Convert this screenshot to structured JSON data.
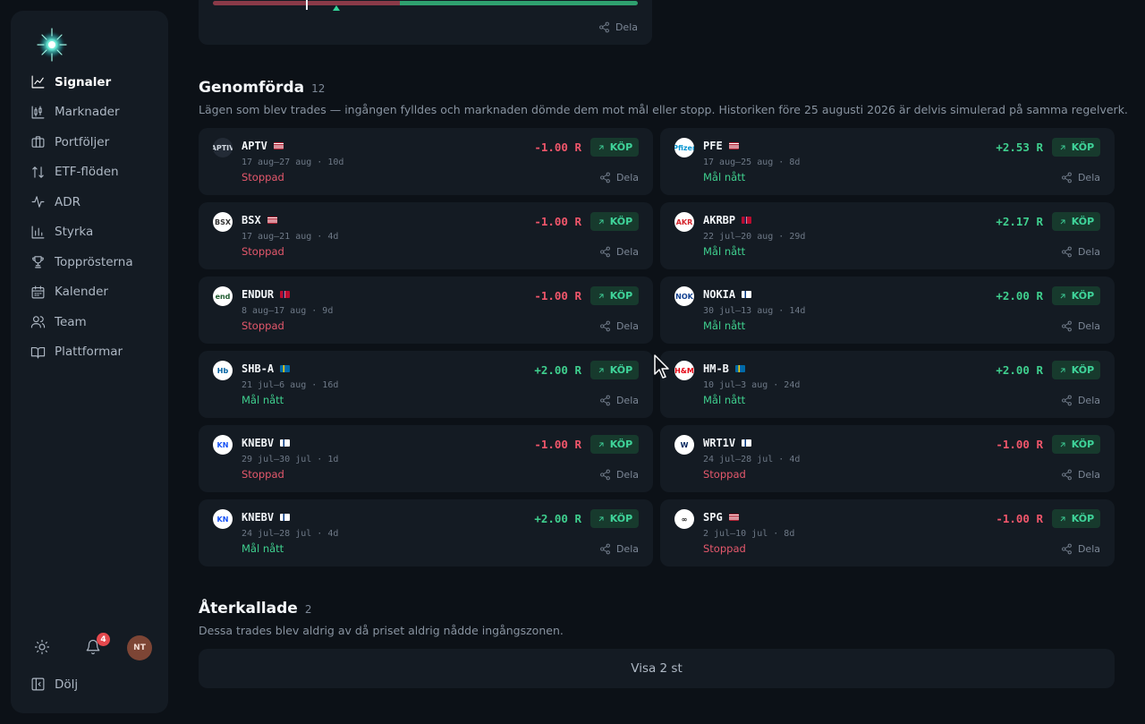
{
  "sidebar": {
    "items": [
      {
        "label": "Signaler",
        "icon": "chart-line-icon",
        "active": true
      },
      {
        "label": "Marknader",
        "icon": "candlestick-icon"
      },
      {
        "label": "Portföljer",
        "icon": "briefcase-icon"
      },
      {
        "label": "ETF-flöden",
        "icon": "arrows-updown-icon"
      },
      {
        "label": "ADR",
        "icon": "pulse-icon"
      },
      {
        "label": "Styrka",
        "icon": "bar-chart-icon"
      },
      {
        "label": "Topprösterna",
        "icon": "trophy-icon"
      },
      {
        "label": "Kalender",
        "icon": "calendar-icon"
      },
      {
        "label": "Team",
        "icon": "users-icon"
      },
      {
        "label": "Plattformar",
        "icon": "book-icon"
      }
    ],
    "notifications_count": "4",
    "avatar_initials": "NT",
    "collapse_label": "Dölj"
  },
  "top_card": {
    "share_label": "Dela",
    "range_bar": {
      "red_fraction": 0.44,
      "grey_fraction": 0.0,
      "green_fraction": 0.56
    }
  },
  "completed": {
    "title": "Genomförda",
    "count": "12",
    "description": "Lägen som blev trades — ingången fylldes och marknaden dömde dem mot mål eller stopp. Historiken före 25 augusti 2026 är delvis simulerad på samma regelverk.",
    "trades": [
      {
        "ticker": "APTV",
        "flag": "us",
        "dates": "17 aug–27 aug · 10d",
        "status": "Stoppad",
        "outcome": "stop",
        "r": "-1.00 R",
        "side": "KÖP",
        "share": "Dela"
      },
      {
        "ticker": "PFE",
        "flag": "us",
        "dates": "17 aug–25 aug · 8d",
        "status": "Mål nått",
        "outcome": "ok",
        "r": "+2.53 R",
        "side": "KÖP",
        "share": "Dela"
      },
      {
        "ticker": "BSX",
        "flag": "us",
        "dates": "17 aug–21 aug · 4d",
        "status": "Stoppad",
        "outcome": "stop",
        "r": "-1.00 R",
        "side": "KÖP",
        "share": "Dela"
      },
      {
        "ticker": "AKRBP",
        "flag": "no",
        "dates": "22 jul–20 aug · 29d",
        "status": "Mål nått",
        "outcome": "ok",
        "r": "+2.17 R",
        "side": "KÖP",
        "share": "Dela"
      },
      {
        "ticker": "ENDUR",
        "flag": "no",
        "dates": "8 aug–17 aug · 9d",
        "status": "Stoppad",
        "outcome": "stop",
        "r": "-1.00 R",
        "side": "KÖP",
        "share": "Dela"
      },
      {
        "ticker": "NOKIA",
        "flag": "fi",
        "dates": "30 jul–13 aug · 14d",
        "status": "Mål nått",
        "outcome": "ok",
        "r": "+2.00 R",
        "side": "KÖP",
        "share": "Dela"
      },
      {
        "ticker": "SHB-A",
        "flag": "se",
        "dates": "21 jul–6 aug · 16d",
        "status": "Mål nått",
        "outcome": "ok",
        "r": "+2.00 R",
        "side": "KÖP",
        "share": "Dela"
      },
      {
        "ticker": "HM-B",
        "flag": "se",
        "dates": "10 jul–3 aug · 24d",
        "status": "Mål nått",
        "outcome": "ok",
        "r": "+2.00 R",
        "side": "KÖP",
        "share": "Dela"
      },
      {
        "ticker": "KNEBV",
        "flag": "fi",
        "dates": "29 jul–30 jul · 1d",
        "status": "Stoppad",
        "outcome": "stop",
        "r": "-1.00 R",
        "side": "KÖP",
        "share": "Dela"
      },
      {
        "ticker": "WRT1V",
        "flag": "fi",
        "dates": "24 jul–28 jul · 4d",
        "status": "Stoppad",
        "outcome": "stop",
        "r": "-1.00 R",
        "side": "KÖP",
        "share": "Dela"
      },
      {
        "ticker": "KNEBV",
        "flag": "fi",
        "dates": "24 jul–28 jul · 4d",
        "status": "Mål nått",
        "outcome": "ok",
        "r": "+2.00 R",
        "side": "KÖP",
        "share": "Dela"
      },
      {
        "ticker": "SPG",
        "flag": "us",
        "dates": "2 jul–10 jul · 8d",
        "status": "Stoppad",
        "outcome": "stop",
        "r": "-1.00 R",
        "side": "KÖP",
        "share": "Dela"
      }
    ]
  },
  "recalled": {
    "title": "Återkallade",
    "count": "2",
    "description": "Dessa trades blev aldrig av då priset aldrig nådde ingångszonen.",
    "show_label": "Visa 2 st"
  },
  "colors": {
    "accent_green": "#3fcf8e",
    "accent_red": "#f0566b",
    "card_bg": "#141b23",
    "page_bg": "#0c1117"
  }
}
